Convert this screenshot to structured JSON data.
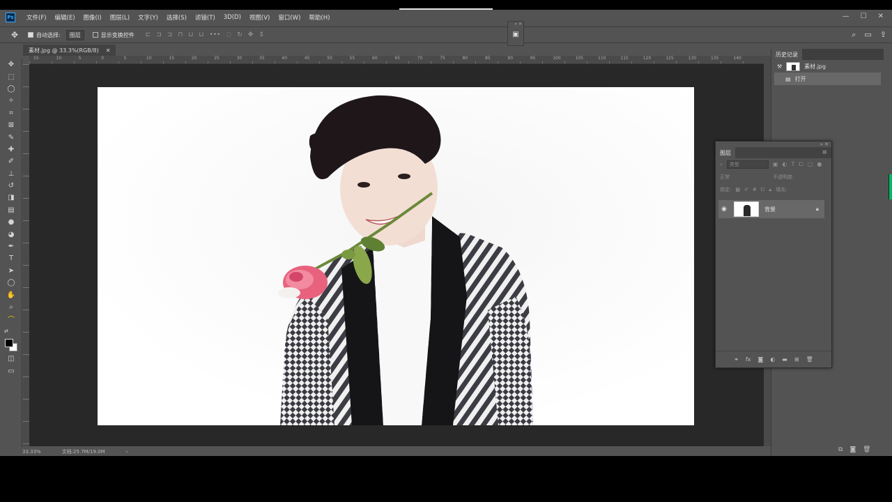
{
  "menu": {
    "items": [
      "文件(F)",
      "编辑(E)",
      "图像(I)",
      "图层(L)",
      "文字(Y)",
      "选择(S)",
      "滤镜(T)",
      "3D(D)",
      "视图(V)",
      "窗口(W)",
      "帮助(H)"
    ]
  },
  "options": {
    "auto_select_label": "自动选择:",
    "auto_select_value": "图层",
    "show_transform_label": "显示变换控件"
  },
  "document": {
    "tab_title": "素材.jpg @ 33.3%(RGB/8)",
    "zoom": "33.33%",
    "doc_size": "文档:25.7M/19.0M"
  },
  "ruler": {
    "ticks": [
      "15",
      "10",
      "5",
      "0",
      "5",
      "10",
      "15",
      "20",
      "25",
      "30",
      "35",
      "40",
      "45",
      "50",
      "55",
      "60",
      "65",
      "70",
      "75",
      "80",
      "85",
      "90",
      "95",
      "100",
      "105",
      "110",
      "115",
      "120",
      "125",
      "130",
      "135",
      "140"
    ]
  },
  "history": {
    "tab_label": "历史记录",
    "snapshot_name": "素材.jpg",
    "steps": [
      "打开"
    ]
  },
  "layers": {
    "tab_label": "图层",
    "filter_placeholder": "类型",
    "blend_mode": "正常",
    "opacity_label": "不透明度:",
    "lock_label": "锁定:",
    "fill_label": "填充:",
    "items": [
      {
        "name": "背景",
        "visible": true,
        "locked": true
      }
    ]
  }
}
